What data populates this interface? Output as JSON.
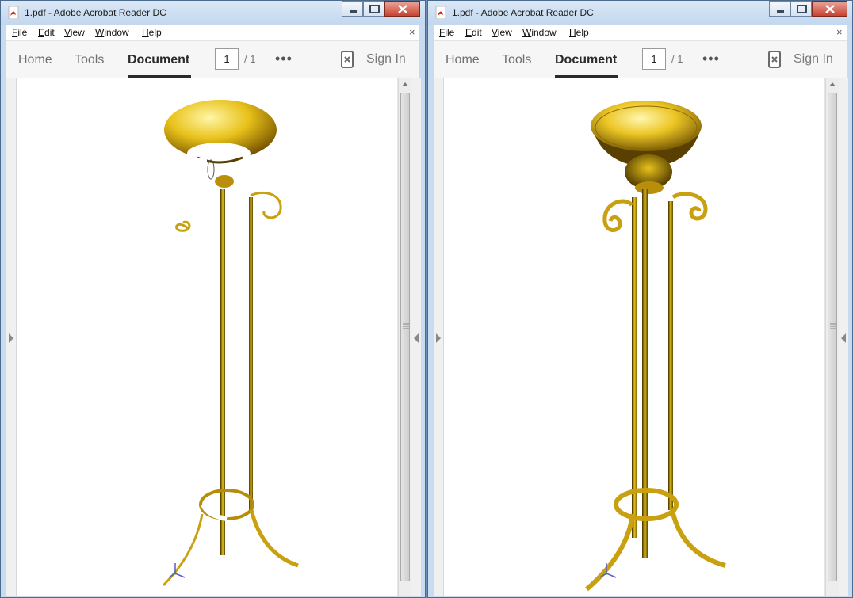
{
  "windows": [
    {
      "title": "1.pdf - Adobe Acrobat Reader DC",
      "menu": [
        "File",
        "Edit",
        "View",
        "Window",
        "Help"
      ],
      "menu_underline": [
        "F",
        "E",
        "V",
        "W",
        "H"
      ],
      "menu_rest": [
        "ile",
        "dit",
        "iew",
        "indow",
        "elp"
      ],
      "doc_close": "×",
      "tabs": [
        "Home",
        "Tools",
        "Document"
      ],
      "active_tab": "Document",
      "page_current": "1",
      "page_total": "/ 1",
      "more": "•••",
      "signin": "Sign In",
      "render_state": "incomplete"
    },
    {
      "title": "1.pdf - Adobe Acrobat Reader DC",
      "menu": [
        "File",
        "Edit",
        "View",
        "Window",
        "Help"
      ],
      "menu_underline": [
        "F",
        "E",
        "V",
        "W",
        "H"
      ],
      "menu_rest": [
        "ile",
        "dit",
        "iew",
        "indow",
        "elp"
      ],
      "doc_close": "×",
      "tabs": [
        "Home",
        "Tools",
        "Document"
      ],
      "active_tab": "Document",
      "page_current": "1",
      "page_total": "/ 1",
      "more": "•••",
      "signin": "Sign In",
      "render_state": "complete"
    }
  ],
  "colors": {
    "gold_light": "#fff3a0",
    "gold": "#e8c21a",
    "gold_dark": "#6b4d00",
    "acrobat_red": "#d7261e"
  }
}
